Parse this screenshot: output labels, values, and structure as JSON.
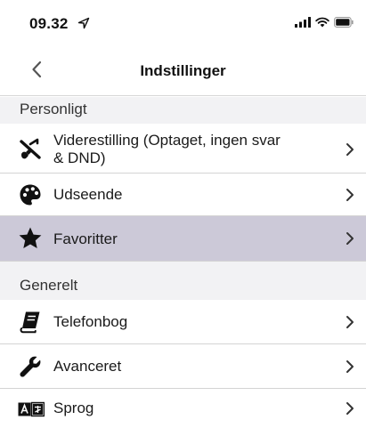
{
  "status": {
    "time": "09.32"
  },
  "nav": {
    "title": "Indstillinger"
  },
  "sections": {
    "personal": {
      "title": "Personligt",
      "items": [
        {
          "label_line1": "Viderestilling (Optaget, ingen svar",
          "label_line2": "& DND)",
          "icon": "call-forward-icon"
        },
        {
          "label": "Udseende",
          "icon": "palette-icon"
        },
        {
          "label": "Favoritter",
          "icon": "star-icon",
          "selected": true
        }
      ]
    },
    "general": {
      "title": "Generelt",
      "items": [
        {
          "label": "Telefonbog",
          "icon": "book-icon"
        },
        {
          "label": "Avanceret",
          "icon": "wrench-icon"
        },
        {
          "label": "Sprog",
          "icon": "language-icon"
        }
      ]
    }
  },
  "colors": {
    "selected_row": "#ccc9d8",
    "section_bg": "#f2f2f4",
    "divider": "#d4d4d4"
  }
}
